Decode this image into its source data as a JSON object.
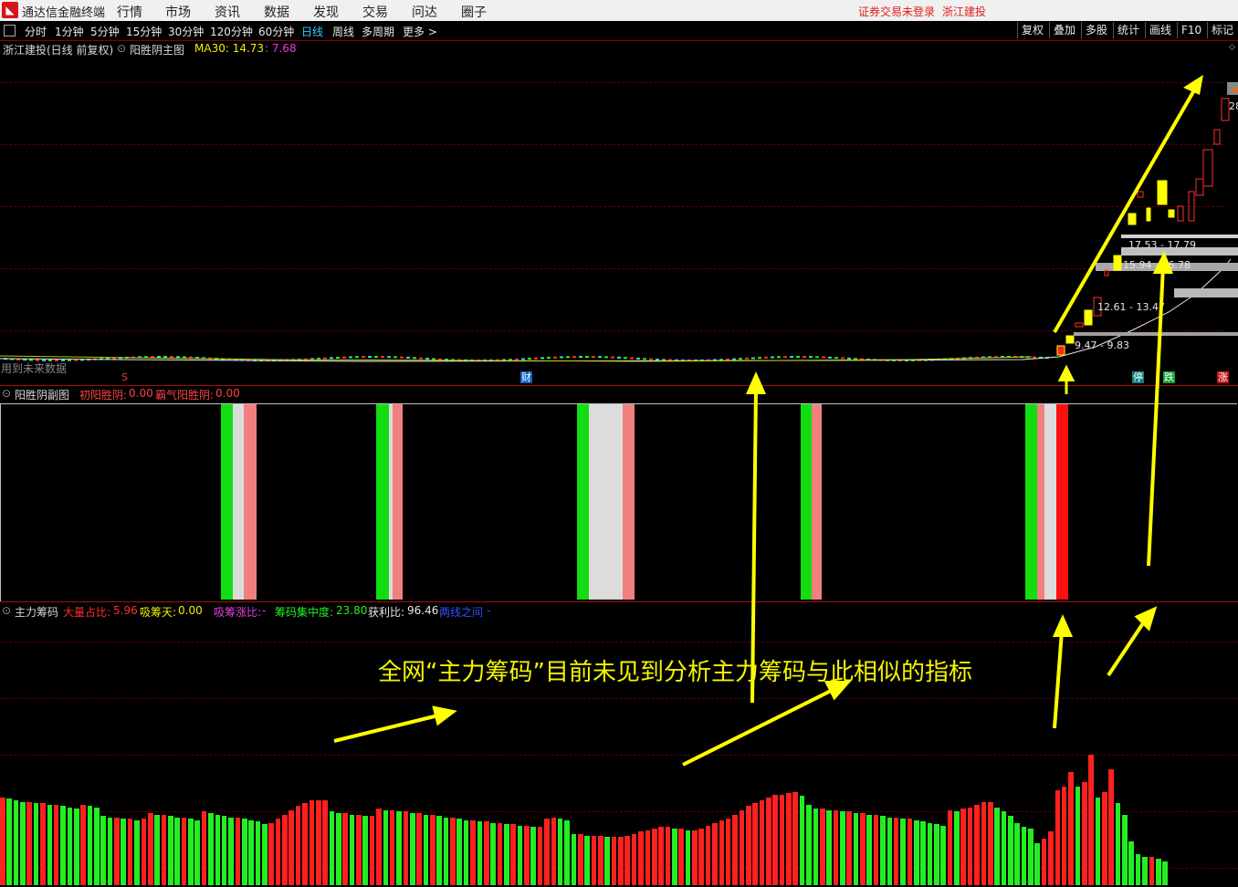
{
  "menu": {
    "app_title": "通达信金融终端",
    "items": [
      "行情",
      "市场",
      "资讯",
      "数据",
      "发现",
      "交易",
      "问达",
      "圈子"
    ],
    "login_status": "证券交易未登录",
    "stock_name": "浙江建投"
  },
  "toolbar": {
    "periods": [
      "分时",
      "1分钟",
      "5分钟",
      "15分钟",
      "30分钟",
      "120分钟",
      "60分钟",
      "日线",
      "周线",
      "多周期",
      "更多 >"
    ],
    "active_period": "日线",
    "right_buttons": [
      "复权",
      "叠加",
      "多股",
      "统计",
      "画线",
      "F10",
      "标记"
    ]
  },
  "main_chart": {
    "title": "浙江建投(日线 前复权)",
    "indicator": "阳胜阴主图",
    "ma_label": "MA30: 14.73",
    "ma_value2": ": 7.68",
    "future_note": "用到未来数据",
    "price_ranges": [
      "17.53 - 17.79",
      "15.94 - 16.78",
      "12.61 - 13.47",
      "9.47 - 9.83"
    ],
    "right_value": "28",
    "markers": {
      "s_marker": "S",
      "cai": "财",
      "ting": "停",
      "die": "跌",
      "zhang": "涨"
    }
  },
  "sub_chart": {
    "title": "阳胜阴副图",
    "label1": "初阳胜阴:",
    "value1": "0.00",
    "label2": "霸气阳胜阴:",
    "value2": "0.00"
  },
  "chip_chart": {
    "title": "主力筹码",
    "label1": "大量占比:",
    "value1": "5.96",
    "label2": "吸筹天:",
    "value2": "0.00",
    "label3": "吸筹涨比:",
    "value3": "-",
    "label4": "筹码集中度:",
    "value4": "23.80",
    "label5": "获利比:",
    "value5": "96.46",
    "label6": "两线之间",
    "value6": "-",
    "annotation": "全网“主力筹码”目前未见到分析主力筹码与此相似的指标"
  },
  "chart_data": {
    "type": "bar",
    "title": "主力筹码",
    "colors": {
      "up": "#ff2020",
      "down": "#22ee22"
    },
    "values": [
      62,
      61,
      60,
      59,
      59,
      58,
      58,
      57,
      57,
      56,
      55,
      54,
      57,
      56,
      55,
      49,
      48,
      48,
      47,
      47,
      46,
      47,
      51,
      50,
      50,
      49,
      48,
      48,
      47,
      46,
      52,
      51,
      50,
      49,
      48,
      48,
      47,
      46,
      45,
      43,
      44,
      47,
      50,
      53,
      56,
      58,
      60,
      60,
      60,
      52,
      51,
      51,
      50,
      50,
      49,
      49,
      54,
      53,
      53,
      52,
      52,
      51,
      51,
      50,
      50,
      49,
      48,
      48,
      47,
      46,
      46,
      45,
      45,
      44,
      44,
      43,
      43,
      42,
      42,
      41,
      41,
      47,
      48,
      47,
      46,
      36,
      36,
      35,
      35,
      35,
      34,
      34,
      34,
      35,
      36,
      38,
      39,
      40,
      41,
      41,
      40,
      40,
      39,
      39,
      40,
      42,
      44,
      46,
      47,
      50,
      53,
      56,
      58,
      60,
      62,
      64,
      64,
      65,
      66,
      63,
      57,
      54,
      54,
      53,
      53,
      52,
      52,
      51,
      51,
      50,
      50,
      49,
      48,
      48,
      47,
      47,
      46,
      45,
      44,
      43,
      42,
      53,
      52,
      54,
      55,
      57,
      59,
      59,
      55,
      52,
      49,
      44,
      41,
      40,
      30,
      33,
      38,
      67,
      70,
      80,
      70,
      73,
      92,
      62,
      66,
      82,
      58,
      50,
      31,
      22,
      20,
      20,
      19,
      17
    ]
  }
}
